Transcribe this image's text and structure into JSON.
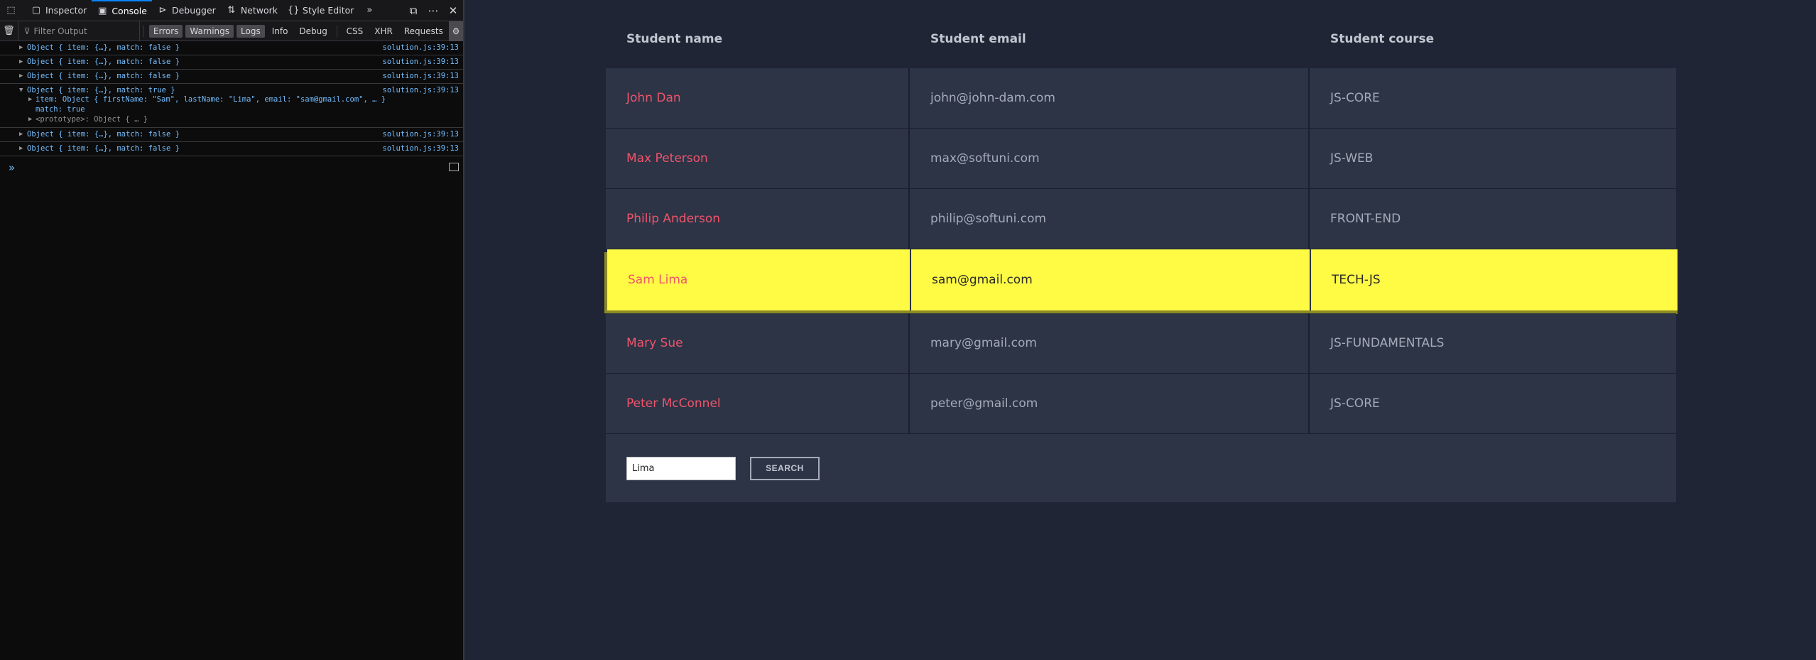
{
  "devtools": {
    "tabs": [
      {
        "label": "Inspector",
        "icon": "inspector-icon"
      },
      {
        "label": "Console",
        "icon": "console-icon"
      },
      {
        "label": "Debugger",
        "icon": "debugger-icon"
      },
      {
        "label": "Network",
        "icon": "network-icon"
      },
      {
        "label": "Style Editor",
        "icon": "style-editor-icon"
      }
    ],
    "active_tab": "Console",
    "filter_placeholder": "Filter Output",
    "filter_buttons": [
      "Errors",
      "Warnings",
      "Logs",
      "Info",
      "Debug",
      "CSS",
      "XHR",
      "Requests"
    ],
    "active_filters": [
      "Errors",
      "Warnings",
      "Logs"
    ],
    "logs": [
      {
        "text": "Object { item: {…}, match: false }",
        "source": "solution.js:39:13"
      },
      {
        "text": "Object { item: {…}, match: false }",
        "source": "solution.js:39:13"
      },
      {
        "text": "Object { item: {…}, match: false }",
        "source": "solution.js:39:13"
      },
      {
        "text": "Object { item: {…}, match: true }",
        "source": "solution.js:39:13"
      },
      {
        "text": "Object { item: {…}, match: false }",
        "source": "solution.js:39:13"
      },
      {
        "text": "Object { item: {…}, match: false }",
        "source": "solution.js:39:13"
      }
    ],
    "expanded": {
      "item_line": "item: Object { firstName: \"Sam\", lastName: \"Lima\", email: \"sam@gmail.com\", … }",
      "match_line": "match: true",
      "proto_line": "<prototype>: Object { … }"
    },
    "prompt": "»"
  },
  "table": {
    "headers": [
      "Student name",
      "Student email",
      "Student course"
    ],
    "rows": [
      {
        "name": "John Dan",
        "email": "john@john-dam.com",
        "course": "JS-CORE"
      },
      {
        "name": "Max Peterson",
        "email": "max@softuni.com",
        "course": "JS-WEB"
      },
      {
        "name": "Philip Anderson",
        "email": "philip@softuni.com",
        "course": "FRONT-END"
      },
      {
        "name": "Sam Lima",
        "email": "sam@gmail.com",
        "course": "TECH-JS"
      },
      {
        "name": "Mary Sue",
        "email": "mary@gmail.com",
        "course": "JS-FUNDAMENTALS"
      },
      {
        "name": "Peter McConnel",
        "email": "peter@gmail.com",
        "course": "JS-CORE"
      }
    ],
    "highlighted_row": "Sam Lima",
    "highlight_color": "#fffa44"
  },
  "search": {
    "value": "Lima",
    "button_label": "SEARCH"
  }
}
